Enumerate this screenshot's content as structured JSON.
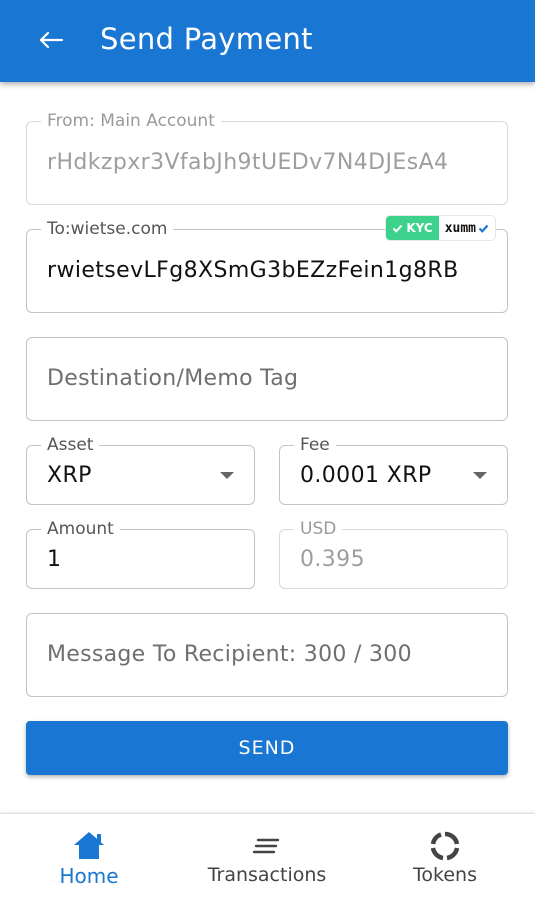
{
  "header": {
    "title": "Send Payment",
    "back_icon": "arrow-left-icon"
  },
  "form": {
    "from": {
      "label": "From: Main Account",
      "value": "rHdkzpxr3VfabJh9tUEDv7N4DJEsA4"
    },
    "to": {
      "label": "To:wietse.com",
      "value": "rwietsevLFg8XSmG3bEZzFein1g8RB",
      "badge_kyc": "KYC",
      "badge_brand": "xumm"
    },
    "destination_tag": {
      "placeholder": "Destination/Memo Tag"
    },
    "asset": {
      "label": "Asset",
      "value": "XRP"
    },
    "fee": {
      "label": "Fee",
      "value": "0.0001 XRP"
    },
    "amount": {
      "label": "Amount",
      "value": "1"
    },
    "usd": {
      "label": "USD",
      "value": "0.395"
    },
    "message": {
      "placeholder": "Message To Recipient: 300 / 300"
    }
  },
  "send_button": {
    "label": "SEND"
  },
  "bottom_nav": {
    "items": [
      {
        "label": "Home",
        "icon": "home-icon",
        "active": true
      },
      {
        "label": "Transactions",
        "icon": "list-icon",
        "active": false
      },
      {
        "label": "Tokens",
        "icon": "tokens-icon",
        "active": false
      }
    ]
  },
  "colors": {
    "primary": "#1976d2",
    "kyc": "#3cd28b"
  }
}
